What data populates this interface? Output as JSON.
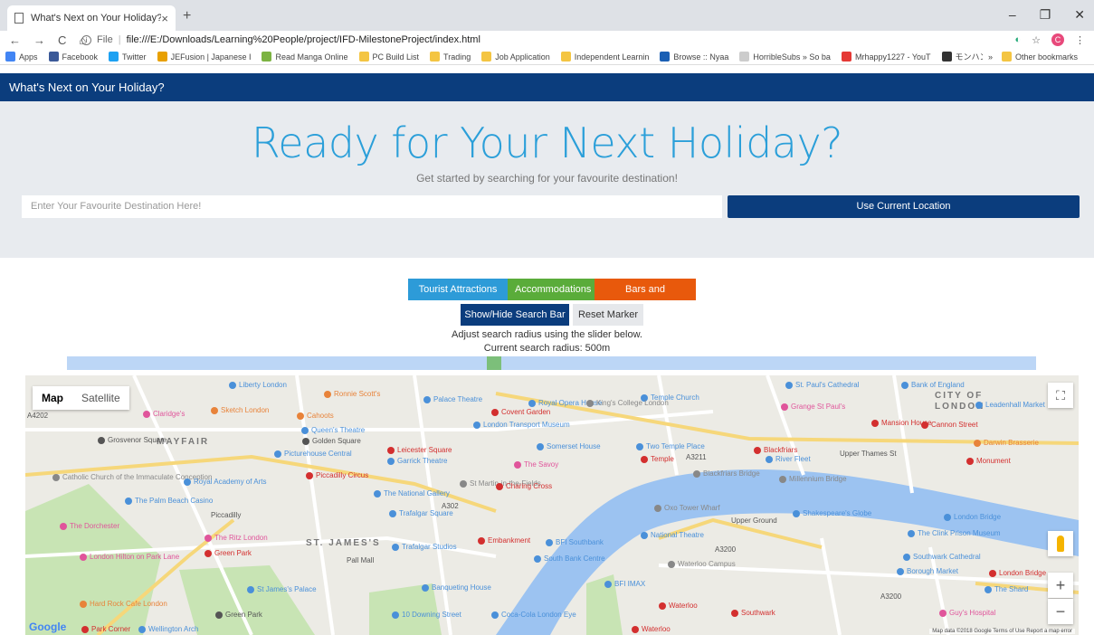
{
  "browser": {
    "tab_title": "What's Next on Your Holiday?",
    "tab_close": "×",
    "new_tab": "+",
    "window_controls": [
      "–",
      "❐",
      "✕"
    ],
    "address_prefix": "File",
    "url": "file:///E:/Downloads/Learning%20People/project/IFD-MilestoneProject/index.html",
    "profile_initial": "C",
    "bookmarks": [
      {
        "label": "Apps",
        "color": "#4285f4"
      },
      {
        "label": "Facebook",
        "color": "#3b5998"
      },
      {
        "label": "Twitter",
        "color": "#1da1f2"
      },
      {
        "label": "JEFusion | Japanese I",
        "color": "#e8a000"
      },
      {
        "label": "Read Manga Online",
        "color": "#7cb342"
      },
      {
        "label": "PC Build List",
        "color": "#f4c542"
      },
      {
        "label": "Trading",
        "color": "#f4c542"
      },
      {
        "label": "Job Application",
        "color": "#f4c542"
      },
      {
        "label": "Independent Learnin",
        "color": "#f4c542"
      },
      {
        "label": "Browse :: Nyaa",
        "color": "#1a5fb4"
      },
      {
        "label": "HorribleSubs » So ba",
        "color": "#cccccc"
      },
      {
        "label": "Mrhappy1227 - YouT",
        "color": "#e53935"
      },
      {
        "label": "モンハンダブルクロス(M",
        "color": "#333333"
      }
    ],
    "bookmarks_more": "»",
    "other_bookmarks": "Other bookmarks"
  },
  "navbar": {
    "brand": "What's Next on Your Holiday?"
  },
  "hero": {
    "title": "Ready for Your Next Holiday?",
    "subtitle": "Get started by searching for your favourite destination!",
    "search_placeholder": "Enter Your Favourite Destination Here!",
    "current_location_button": "Use Current Location"
  },
  "filters": {
    "tourist": "Tourist Attractions ▾",
    "accommodations": "Accommodations",
    "bars": "Bars and Restaurants"
  },
  "controls": {
    "show_hide": "Show/Hide Search Bar",
    "reset": "Reset Marker",
    "adjust_text": "Adjust search radius using the slider below.",
    "radius_text": "Current search radius: 500m"
  },
  "slider": {
    "value_fraction": 0.44
  },
  "map": {
    "type_map": "Map",
    "type_satellite": "Satellite",
    "zoom_in": "+",
    "zoom_out": "−",
    "fullscreen": "⛶",
    "google": "Google",
    "attribution": "Map data ©2018 Google   Terms of Use   Report a map error",
    "district_labels": [
      "MAYFAIR",
      "ST. JAMES'S",
      "CITY OF",
      "LONDON"
    ],
    "places": [
      {
        "name": "Liberty London",
        "color": "#4a90d9"
      },
      {
        "name": "Ronnie Scott's",
        "color": "#e8833a"
      },
      {
        "name": "Palace Theatre",
        "color": "#4a90d9"
      },
      {
        "name": "Royal Opera House",
        "color": "#4a90d9"
      },
      {
        "name": "Temple Church",
        "color": "#4a90d9"
      },
      {
        "name": "St. Paul's Cathedral",
        "color": "#4a90d9"
      },
      {
        "name": "Bank of England",
        "color": "#4a90d9"
      },
      {
        "name": "Claridge's",
        "color": "#e0559b"
      },
      {
        "name": "Sketch London",
        "color": "#e8833a"
      },
      {
        "name": "Cahoots",
        "color": "#e8833a"
      },
      {
        "name": "Covent Garden",
        "color": "#d32f2f"
      },
      {
        "name": "King's College London",
        "color": "#888888"
      },
      {
        "name": "Grange St Paul's",
        "color": "#e0559b"
      },
      {
        "name": "Mansion House",
        "color": "#d32f2f"
      },
      {
        "name": "Leadenhall Market",
        "color": "#4a90d9"
      },
      {
        "name": "Queen's Theatre",
        "color": "#4a90d9"
      },
      {
        "name": "London Transport Museum",
        "color": "#4a90d9"
      },
      {
        "name": "Golden Square",
        "color": "#555555"
      },
      {
        "name": "Somerset House",
        "color": "#4a90d9"
      },
      {
        "name": "Two Temple Place",
        "color": "#4a90d9"
      },
      {
        "name": "Blackfriars",
        "color": "#d32f2f"
      },
      {
        "name": "Cannon Street",
        "color": "#d32f2f"
      },
      {
        "name": "Darwin Brasserie",
        "color": "#e8833a"
      },
      {
        "name": "Grosvenor Square",
        "color": "#555555"
      },
      {
        "name": "Picturehouse Central",
        "color": "#4a90d9"
      },
      {
        "name": "Leicester Square",
        "color": "#d32f2f"
      },
      {
        "name": "Garrick Theatre",
        "color": "#4a90d9"
      },
      {
        "name": "The Savoy",
        "color": "#e0559b"
      },
      {
        "name": "Temple",
        "color": "#d32f2f"
      },
      {
        "name": "River Fleet",
        "color": "#4a90d9"
      },
      {
        "name": "Monument",
        "color": "#d32f2f"
      },
      {
        "name": "Piccadilly Circus",
        "color": "#d32f2f"
      },
      {
        "name": "Blackfriars Bridge",
        "color": "#888888"
      },
      {
        "name": "Millennium Bridge",
        "color": "#888888"
      },
      {
        "name": "Catholic Church of the Immaculate Conception",
        "color": "#888888"
      },
      {
        "name": "Royal Academy of Arts",
        "color": "#4a90d9"
      },
      {
        "name": "St Martin-in-the-Fields",
        "color": "#888888"
      },
      {
        "name": "The Palm Beach Casino",
        "color": "#4a90d9"
      },
      {
        "name": "The National Gallery",
        "color": "#4a90d9"
      },
      {
        "name": "Charing Cross",
        "color": "#d32f2f"
      },
      {
        "name": "Oxo Tower Wharf",
        "color": "#888888"
      },
      {
        "name": "Shakespeare's Globe",
        "color": "#4a90d9"
      },
      {
        "name": "London Bridge",
        "color": "#4a90d9"
      },
      {
        "name": "Trafalgar Square",
        "color": "#4a90d9"
      },
      {
        "name": "The Dorchester",
        "color": "#e0559b"
      },
      {
        "name": "The Ritz London",
        "color": "#e0559b"
      },
      {
        "name": "Embankment",
        "color": "#d32f2f"
      },
      {
        "name": "BFI Southbank",
        "color": "#4a90d9"
      },
      {
        "name": "National Theatre",
        "color": "#4a90d9"
      },
      {
        "name": "The Clink Prison Museum",
        "color": "#4a90d9"
      },
      {
        "name": "Green Park",
        "color": "#d32f2f"
      },
      {
        "name": "Trafalgar Studios",
        "color": "#4a90d9"
      },
      {
        "name": "South Bank Centre",
        "color": "#4a90d9"
      },
      {
        "name": "Waterloo Campus",
        "color": "#888888"
      },
      {
        "name": "Southwark Cathedral",
        "color": "#4a90d9"
      },
      {
        "name": "London Hilton on Park Lane",
        "color": "#e0559b"
      },
      {
        "name": "Borough Market",
        "color": "#4a90d9"
      },
      {
        "name": "London Bridge",
        "color": "#d32f2f"
      },
      {
        "name": "St James's Palace",
        "color": "#4a90d9"
      },
      {
        "name": "BFI IMAX",
        "color": "#4a90d9"
      },
      {
        "name": "Banqueting House",
        "color": "#4a90d9"
      },
      {
        "name": "The Shard",
        "color": "#4a90d9"
      },
      {
        "name": "Hard Rock Cafe London",
        "color": "#e8833a"
      },
      {
        "name": "Green Park",
        "color": "#555555"
      },
      {
        "name": "Waterloo",
        "color": "#d32f2f"
      },
      {
        "name": "Southwark",
        "color": "#d32f2f"
      },
      {
        "name": "Guy's Hospital",
        "color": "#e0559b"
      },
      {
        "name": "10 Downing Street",
        "color": "#4a90d9"
      },
      {
        "name": "Coca-Cola London Eye",
        "color": "#4a90d9"
      },
      {
        "name": "Park Corner",
        "color": "#d32f2f"
      },
      {
        "name": "Wellington Arch",
        "color": "#4a90d9"
      },
      {
        "name": "Waterloo",
        "color": "#d32f2f"
      }
    ],
    "road_labels": [
      "A3211",
      "Upper Thames St",
      "A3200",
      "A3200",
      "A302",
      "A4202",
      "Pall Mall",
      "Piccadilly",
      "Upper Ground"
    ]
  }
}
